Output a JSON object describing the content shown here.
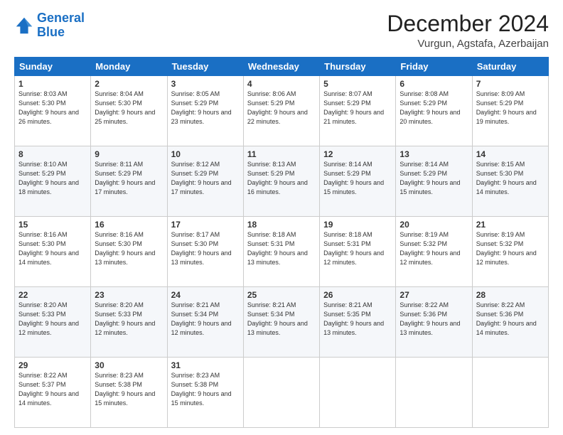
{
  "logo": {
    "line1": "General",
    "line2": "Blue"
  },
  "title": "December 2024",
  "location": "Vurgun, Agstafa, Azerbaijan",
  "days_header": [
    "Sunday",
    "Monday",
    "Tuesday",
    "Wednesday",
    "Thursday",
    "Friday",
    "Saturday"
  ],
  "weeks": [
    [
      {
        "day": "1",
        "sunrise": "8:03 AM",
        "sunset": "5:30 PM",
        "daylight": "9 hours and 26 minutes."
      },
      {
        "day": "2",
        "sunrise": "8:04 AM",
        "sunset": "5:30 PM",
        "daylight": "9 hours and 25 minutes."
      },
      {
        "day": "3",
        "sunrise": "8:05 AM",
        "sunset": "5:29 PM",
        "daylight": "9 hours and 23 minutes."
      },
      {
        "day": "4",
        "sunrise": "8:06 AM",
        "sunset": "5:29 PM",
        "daylight": "9 hours and 22 minutes."
      },
      {
        "day": "5",
        "sunrise": "8:07 AM",
        "sunset": "5:29 PM",
        "daylight": "9 hours and 21 minutes."
      },
      {
        "day": "6",
        "sunrise": "8:08 AM",
        "sunset": "5:29 PM",
        "daylight": "9 hours and 20 minutes."
      },
      {
        "day": "7",
        "sunrise": "8:09 AM",
        "sunset": "5:29 PM",
        "daylight": "9 hours and 19 minutes."
      }
    ],
    [
      {
        "day": "8",
        "sunrise": "8:10 AM",
        "sunset": "5:29 PM",
        "daylight": "9 hours and 18 minutes."
      },
      {
        "day": "9",
        "sunrise": "8:11 AM",
        "sunset": "5:29 PM",
        "daylight": "9 hours and 17 minutes."
      },
      {
        "day": "10",
        "sunrise": "8:12 AM",
        "sunset": "5:29 PM",
        "daylight": "9 hours and 17 minutes."
      },
      {
        "day": "11",
        "sunrise": "8:13 AM",
        "sunset": "5:29 PM",
        "daylight": "9 hours and 16 minutes."
      },
      {
        "day": "12",
        "sunrise": "8:14 AM",
        "sunset": "5:29 PM",
        "daylight": "9 hours and 15 minutes."
      },
      {
        "day": "13",
        "sunrise": "8:14 AM",
        "sunset": "5:29 PM",
        "daylight": "9 hours and 15 minutes."
      },
      {
        "day": "14",
        "sunrise": "8:15 AM",
        "sunset": "5:30 PM",
        "daylight": "9 hours and 14 minutes."
      }
    ],
    [
      {
        "day": "15",
        "sunrise": "8:16 AM",
        "sunset": "5:30 PM",
        "daylight": "9 hours and 14 minutes."
      },
      {
        "day": "16",
        "sunrise": "8:16 AM",
        "sunset": "5:30 PM",
        "daylight": "9 hours and 13 minutes."
      },
      {
        "day": "17",
        "sunrise": "8:17 AM",
        "sunset": "5:30 PM",
        "daylight": "9 hours and 13 minutes."
      },
      {
        "day": "18",
        "sunrise": "8:18 AM",
        "sunset": "5:31 PM",
        "daylight": "9 hours and 13 minutes."
      },
      {
        "day": "19",
        "sunrise": "8:18 AM",
        "sunset": "5:31 PM",
        "daylight": "9 hours and 12 minutes."
      },
      {
        "day": "20",
        "sunrise": "8:19 AM",
        "sunset": "5:32 PM",
        "daylight": "9 hours and 12 minutes."
      },
      {
        "day": "21",
        "sunrise": "8:19 AM",
        "sunset": "5:32 PM",
        "daylight": "9 hours and 12 minutes."
      }
    ],
    [
      {
        "day": "22",
        "sunrise": "8:20 AM",
        "sunset": "5:33 PM",
        "daylight": "9 hours and 12 minutes."
      },
      {
        "day": "23",
        "sunrise": "8:20 AM",
        "sunset": "5:33 PM",
        "daylight": "9 hours and 12 minutes."
      },
      {
        "day": "24",
        "sunrise": "8:21 AM",
        "sunset": "5:34 PM",
        "daylight": "9 hours and 12 minutes."
      },
      {
        "day": "25",
        "sunrise": "8:21 AM",
        "sunset": "5:34 PM",
        "daylight": "9 hours and 13 minutes."
      },
      {
        "day": "26",
        "sunrise": "8:21 AM",
        "sunset": "5:35 PM",
        "daylight": "9 hours and 13 minutes."
      },
      {
        "day": "27",
        "sunrise": "8:22 AM",
        "sunset": "5:36 PM",
        "daylight": "9 hours and 13 minutes."
      },
      {
        "day": "28",
        "sunrise": "8:22 AM",
        "sunset": "5:36 PM",
        "daylight": "9 hours and 14 minutes."
      }
    ],
    [
      {
        "day": "29",
        "sunrise": "8:22 AM",
        "sunset": "5:37 PM",
        "daylight": "9 hours and 14 minutes."
      },
      {
        "day": "30",
        "sunrise": "8:23 AM",
        "sunset": "5:38 PM",
        "daylight": "9 hours and 15 minutes."
      },
      {
        "day": "31",
        "sunrise": "8:23 AM",
        "sunset": "5:38 PM",
        "daylight": "9 hours and 15 minutes."
      },
      null,
      null,
      null,
      null
    ]
  ]
}
